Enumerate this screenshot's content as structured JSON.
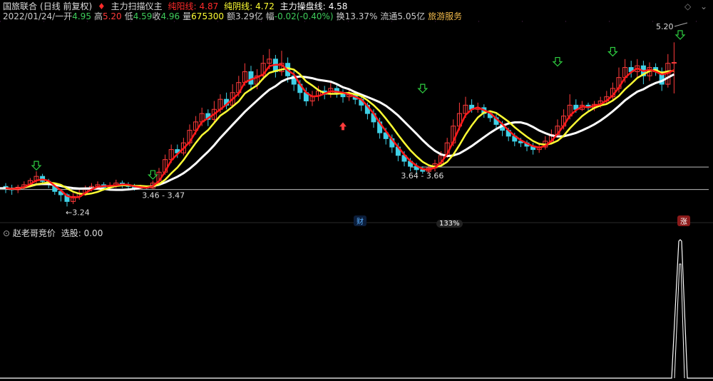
{
  "header": {
    "stock_name": "国旅联合",
    "period": "(日线 前复权)",
    "indicator_name": "主力扫描仪主",
    "line1_label": "纯阳线:",
    "line1_value": "4.87",
    "line2_label": "纯阴线:",
    "line2_value": "4.72",
    "line3_label": "主力操盘线:",
    "line3_value": "4.58"
  },
  "quote": {
    "date": "2022/01/24/一",
    "open_label": "开",
    "open": "4.95",
    "high_label": "高",
    "high": "5.20",
    "low_label": "低",
    "low": "4.59",
    "close_label": "收",
    "close": "4.96",
    "volume_label": "量",
    "volume": "675300",
    "amount_label": "额",
    "amount": "3.29亿",
    "change_label": "幅",
    "change": "-0.02(-0.40%)",
    "turnover_label": "换",
    "turnover": "13.37%",
    "float_label": "流通",
    "float": "5.05亿",
    "sector": "旅游服务"
  },
  "sub_header": {
    "indicator": "赵老哥竞价",
    "select_label": "选股:",
    "select_value": "0.00"
  },
  "badges": {
    "cai": "财",
    "zoom": "133%",
    "zhang": "涨"
  },
  "colors": {
    "up": "#ff3b3b",
    "down": "#3fd0e6",
    "line_red": "#ff1a1a",
    "line_yellow": "#ffff33",
    "line_white": "#ffffff",
    "green_arrow": "#2ecc40"
  },
  "chart_data": {
    "type": "candlestick",
    "annotations": {
      "high_label": "5.20",
      "low_label": "3.24",
      "range1": "3.46 - 3.47",
      "range2": "3.64 - 3.66"
    },
    "support_levels": [
      3.46,
      3.66
    ],
    "price_range": [
      3.15,
      5.45
    ],
    "candles": [
      [
        3.48,
        3.46,
        3.52,
        3.4
      ],
      [
        3.46,
        3.44,
        3.5,
        3.38
      ],
      [
        3.44,
        3.47,
        3.5,
        3.4
      ],
      [
        3.47,
        3.5,
        3.54,
        3.44
      ],
      [
        3.5,
        3.55,
        3.58,
        3.47
      ],
      [
        3.55,
        3.6,
        3.66,
        3.52
      ],
      [
        3.6,
        3.54,
        3.63,
        3.5
      ],
      [
        3.54,
        3.5,
        3.57,
        3.46
      ],
      [
        3.5,
        3.42,
        3.52,
        3.38
      ],
      [
        3.42,
        3.38,
        3.45,
        3.3
      ],
      [
        3.38,
        3.3,
        3.4,
        3.24
      ],
      [
        3.3,
        3.36,
        3.4,
        3.27
      ],
      [
        3.36,
        3.4,
        3.44,
        3.32
      ],
      [
        3.4,
        3.45,
        3.49,
        3.37
      ],
      [
        3.45,
        3.48,
        3.52,
        3.42
      ],
      [
        3.48,
        3.5,
        3.54,
        3.45
      ],
      [
        3.5,
        3.47,
        3.53,
        3.43
      ],
      [
        3.47,
        3.49,
        3.53,
        3.44
      ],
      [
        3.49,
        3.52,
        3.56,
        3.46
      ],
      [
        3.52,
        3.5,
        3.55,
        3.46
      ],
      [
        3.5,
        3.48,
        3.53,
        3.44
      ],
      [
        3.48,
        3.46,
        3.51,
        3.43
      ],
      [
        3.46,
        3.47,
        3.5,
        3.44
      ],
      [
        3.47,
        3.46,
        3.49,
        3.44
      ],
      [
        3.46,
        3.52,
        3.55,
        3.45
      ],
      [
        3.52,
        3.65,
        3.7,
        3.5
      ],
      [
        3.65,
        3.8,
        3.86,
        3.62
      ],
      [
        3.8,
        3.92,
        3.98,
        3.76
      ],
      [
        3.92,
        3.88,
        3.98,
        3.82
      ],
      [
        3.88,
        4.0,
        4.06,
        3.85
      ],
      [
        4.0,
        4.15,
        4.22,
        3.96
      ],
      [
        4.15,
        4.25,
        4.32,
        4.1
      ],
      [
        4.25,
        4.35,
        4.42,
        4.2
      ],
      [
        4.35,
        4.28,
        4.4,
        4.2
      ],
      [
        4.28,
        4.4,
        4.5,
        4.24
      ],
      [
        4.4,
        4.52,
        4.58,
        4.36
      ],
      [
        4.52,
        4.45,
        4.6,
        4.4
      ],
      [
        4.45,
        4.6,
        4.7,
        4.42
      ],
      [
        4.6,
        4.72,
        4.8,
        4.55
      ],
      [
        4.72,
        4.85,
        4.95,
        4.68
      ],
      [
        4.85,
        4.7,
        4.92,
        4.62
      ],
      [
        4.7,
        4.8,
        4.88,
        4.64
      ],
      [
        4.8,
        4.95,
        5.05,
        4.75
      ],
      [
        4.95,
        5.0,
        5.12,
        4.88
      ],
      [
        5.0,
        4.85,
        5.05,
        4.78
      ],
      [
        4.85,
        4.95,
        5.1,
        4.8
      ],
      [
        4.95,
        4.8,
        5.02,
        4.72
      ],
      [
        4.8,
        4.7,
        4.86,
        4.62
      ],
      [
        4.7,
        4.6,
        4.75,
        4.52
      ],
      [
        4.6,
        4.5,
        4.66,
        4.44
      ],
      [
        4.5,
        4.56,
        4.62,
        4.44
      ],
      [
        4.56,
        4.62,
        4.68,
        4.5
      ],
      [
        4.62,
        4.58,
        4.68,
        4.52
      ],
      [
        4.58,
        4.65,
        4.72,
        4.54
      ],
      [
        4.65,
        4.6,
        4.7,
        4.54
      ],
      [
        4.6,
        4.55,
        4.64,
        4.48
      ],
      [
        4.55,
        4.58,
        4.63,
        4.5
      ],
      [
        4.58,
        4.52,
        4.62,
        4.46
      ],
      [
        4.52,
        4.45,
        4.56,
        4.38
      ],
      [
        4.45,
        4.35,
        4.48,
        4.28
      ],
      [
        4.35,
        4.25,
        4.4,
        4.18
      ],
      [
        4.25,
        4.12,
        4.3,
        4.05
      ],
      [
        4.12,
        4.05,
        4.18,
        3.98
      ],
      [
        4.05,
        3.95,
        4.1,
        3.88
      ],
      [
        3.95,
        3.85,
        4.0,
        3.78
      ],
      [
        3.85,
        3.78,
        3.9,
        3.72
      ],
      [
        3.78,
        3.72,
        3.82,
        3.66
      ],
      [
        3.72,
        3.68,
        3.76,
        3.64
      ],
      [
        3.68,
        3.66,
        3.72,
        3.63
      ],
      [
        3.66,
        3.7,
        3.74,
        3.64
      ],
      [
        3.7,
        3.75,
        3.8,
        3.66
      ],
      [
        3.75,
        3.85,
        3.9,
        3.72
      ],
      [
        3.85,
        4.0,
        4.06,
        3.82
      ],
      [
        4.0,
        4.2,
        4.28,
        3.96
      ],
      [
        4.2,
        4.35,
        4.48,
        4.15
      ],
      [
        4.35,
        4.45,
        4.55,
        4.3
      ],
      [
        4.45,
        4.4,
        4.52,
        4.36
      ],
      [
        4.4,
        4.42,
        4.48,
        4.36
      ],
      [
        4.42,
        4.35,
        4.46,
        4.3
      ],
      [
        4.35,
        4.3,
        4.38,
        4.25
      ],
      [
        4.3,
        4.22,
        4.34,
        4.16
      ],
      [
        4.22,
        4.15,
        4.26,
        4.08
      ],
      [
        4.15,
        4.08,
        4.18,
        4.02
      ],
      [
        4.08,
        4.02,
        4.12,
        3.96
      ],
      [
        4.02,
        4.0,
        4.06,
        3.95
      ],
      [
        4.0,
        3.96,
        4.03,
        3.9
      ],
      [
        3.96,
        3.92,
        4.0,
        3.86
      ],
      [
        3.92,
        3.95,
        4.0,
        3.88
      ],
      [
        3.95,
        4.02,
        4.08,
        3.92
      ],
      [
        4.02,
        4.1,
        4.16,
        3.98
      ],
      [
        4.1,
        4.2,
        4.28,
        4.06
      ],
      [
        4.2,
        4.32,
        4.4,
        4.16
      ],
      [
        4.32,
        4.45,
        4.58,
        4.28
      ],
      [
        4.45,
        4.4,
        4.52,
        4.36
      ],
      [
        4.4,
        4.45,
        4.5,
        4.38
      ],
      [
        4.45,
        4.42,
        4.48,
        4.38
      ],
      [
        4.42,
        4.46,
        4.5,
        4.38
      ],
      [
        4.46,
        4.5,
        4.55,
        4.42
      ],
      [
        4.5,
        4.55,
        4.62,
        4.46
      ],
      [
        4.55,
        4.65,
        4.72,
        4.5
      ],
      [
        4.65,
        4.78,
        4.9,
        4.6
      ],
      [
        4.78,
        4.9,
        5.0,
        4.72
      ],
      [
        4.9,
        4.85,
        4.98,
        4.78
      ],
      [
        4.85,
        4.92,
        5.0,
        4.78
      ],
      [
        4.92,
        4.8,
        4.98,
        4.7
      ],
      [
        4.8,
        4.9,
        4.96,
        4.74
      ],
      [
        4.9,
        4.85,
        4.95,
        4.8
      ],
      [
        4.85,
        4.7,
        4.9,
        4.62
      ],
      [
        4.7,
        4.95,
        5.06,
        4.66
      ],
      [
        4.95,
        4.96,
        5.2,
        4.59
      ]
    ],
    "sub_spike_index": 110
  }
}
